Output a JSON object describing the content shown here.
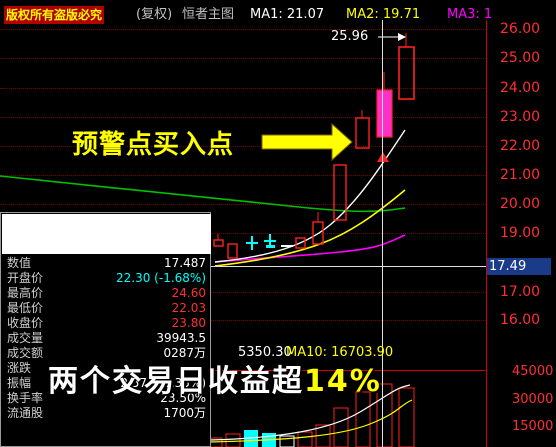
{
  "header": {
    "copyright": "版权所有盗版必究",
    "fuquan": "(复权)",
    "chart_name": "恒者主图",
    "ma1": "MA1: 21.07",
    "ma2": "MA2: 19.71",
    "ma3": "MA3: 1"
  },
  "colors": {
    "up": "#ff2020",
    "down": "#00ffff",
    "ma1": "#ffffff",
    "ma2": "#ffff00",
    "ma3": "#ff00ff",
    "long_ma": "#00c000",
    "volume_axis": "#ff3030"
  },
  "price_axis": {
    "ticks": [
      "26.00",
      "25.00",
      "24.00",
      "23.00",
      "22.00",
      "21.00",
      "20.00",
      "19.00",
      "17.00",
      "16.00"
    ],
    "current": "17.49"
  },
  "peak_label": "25.96",
  "annotation": "预警点买入点",
  "annotation2": {
    "text": "两个交易日收益超",
    "pct": "14%"
  },
  "volume": {
    "left_value": "5350.30",
    "ma10": "MA10: 16703.90",
    "ticks": [
      "45000",
      "30000",
      "15000"
    ]
  },
  "info_panel": {
    "rows": [
      {
        "label": "数值",
        "value": "17.487",
        "color": "#ffffff"
      },
      {
        "label": "开盘价",
        "value": "22.30 (-1.68%)",
        "color": "#00ffff"
      },
      {
        "label": "最高价",
        "value": "24.60",
        "color": "#ff3030"
      },
      {
        "label": "最低价",
        "value": "22.03",
        "color": "#ff3030"
      },
      {
        "label": "收盘价",
        "value": "23.80",
        "color": "#ff3030"
      },
      {
        "label": "成交量",
        "value": "39943.5",
        "color": "#ffffff"
      },
      {
        "label": "成交额",
        "value": "0287万",
        "color": "#ffffff"
      },
      {
        "label": "涨跌",
        "value": "",
        "color": "#ff3030"
      },
      {
        "label": "振幅",
        "value": "2.57 (11.35%)",
        "color": "#ffffff"
      },
      {
        "label": "换手率",
        "value": "23.50%",
        "color": "#ffffff"
      },
      {
        "label": "流通股",
        "value": "1700万",
        "color": "#ffffff"
      }
    ]
  }
}
